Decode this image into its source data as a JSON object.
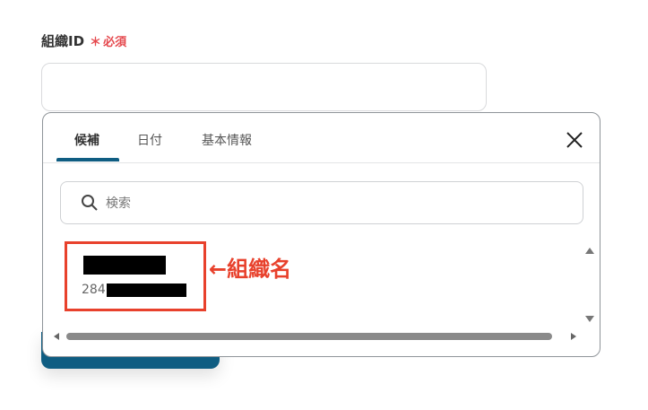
{
  "field": {
    "label": "組織ID",
    "required_mark": "＊",
    "required_text": "必須"
  },
  "popup": {
    "tabs": [
      {
        "label": "候補",
        "active": true
      },
      {
        "label": "日付",
        "active": false
      },
      {
        "label": "基本情報",
        "active": false
      }
    ],
    "search_placeholder": "検索",
    "options": [
      {
        "id_prefix": "284"
      }
    ]
  },
  "annotation": {
    "text": "←組織名"
  },
  "colors": {
    "accent": "#0f5d82",
    "required": "#e5484d",
    "highlight": "#e8412c"
  },
  "icons": [
    "close-icon",
    "search-icon",
    "scroll-up-arrow",
    "scroll-down-arrow",
    "scroll-left-arrow",
    "scroll-right-arrow"
  ]
}
